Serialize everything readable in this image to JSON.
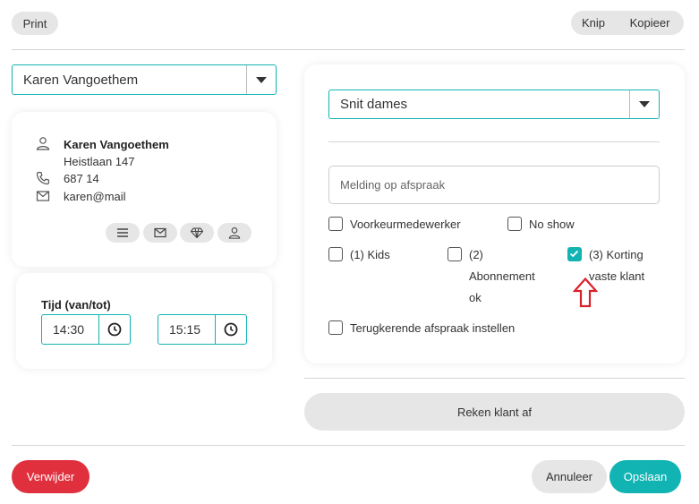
{
  "toolbar": {
    "print_label": "Print",
    "knip_label": "Knip",
    "kopieer_label": "Kopieer"
  },
  "client_select": {
    "value": "Karen Vangoethem"
  },
  "client_card": {
    "name": "Karen Vangoethem",
    "address": "Heistlaan 147",
    "phone": "687 14",
    "email": "karen@mail"
  },
  "time": {
    "label": "Tijd (van/tot)",
    "from": "14:30",
    "to": "15:15"
  },
  "service_select": {
    "value": "Snit dames"
  },
  "note": {
    "placeholder": "Melding op afspraak"
  },
  "options": {
    "voorkeur": "Voorkeurmedewerker",
    "noshow": "No show",
    "kids": "(1) Kids",
    "abonnement_1": "(2)",
    "abonnement_2": "Abonnement",
    "abonnement_3": "ok",
    "korting_1": "(3) Korting",
    "korting_2": "vaste klant",
    "recurring": "Terugkerende afspraak instellen"
  },
  "checkbox_states": {
    "voorkeur": false,
    "noshow": false,
    "kids": false,
    "abonnement": false,
    "korting": true,
    "recurring": false
  },
  "checkout": {
    "label": "Reken klant af"
  },
  "footer": {
    "delete_label": "Verwijder",
    "cancel_label": "Annuleer",
    "save_label": "Opslaan"
  },
  "colors": {
    "accent": "#12b3b3",
    "danger": "#e0303e",
    "arrow": "#d8202a"
  }
}
